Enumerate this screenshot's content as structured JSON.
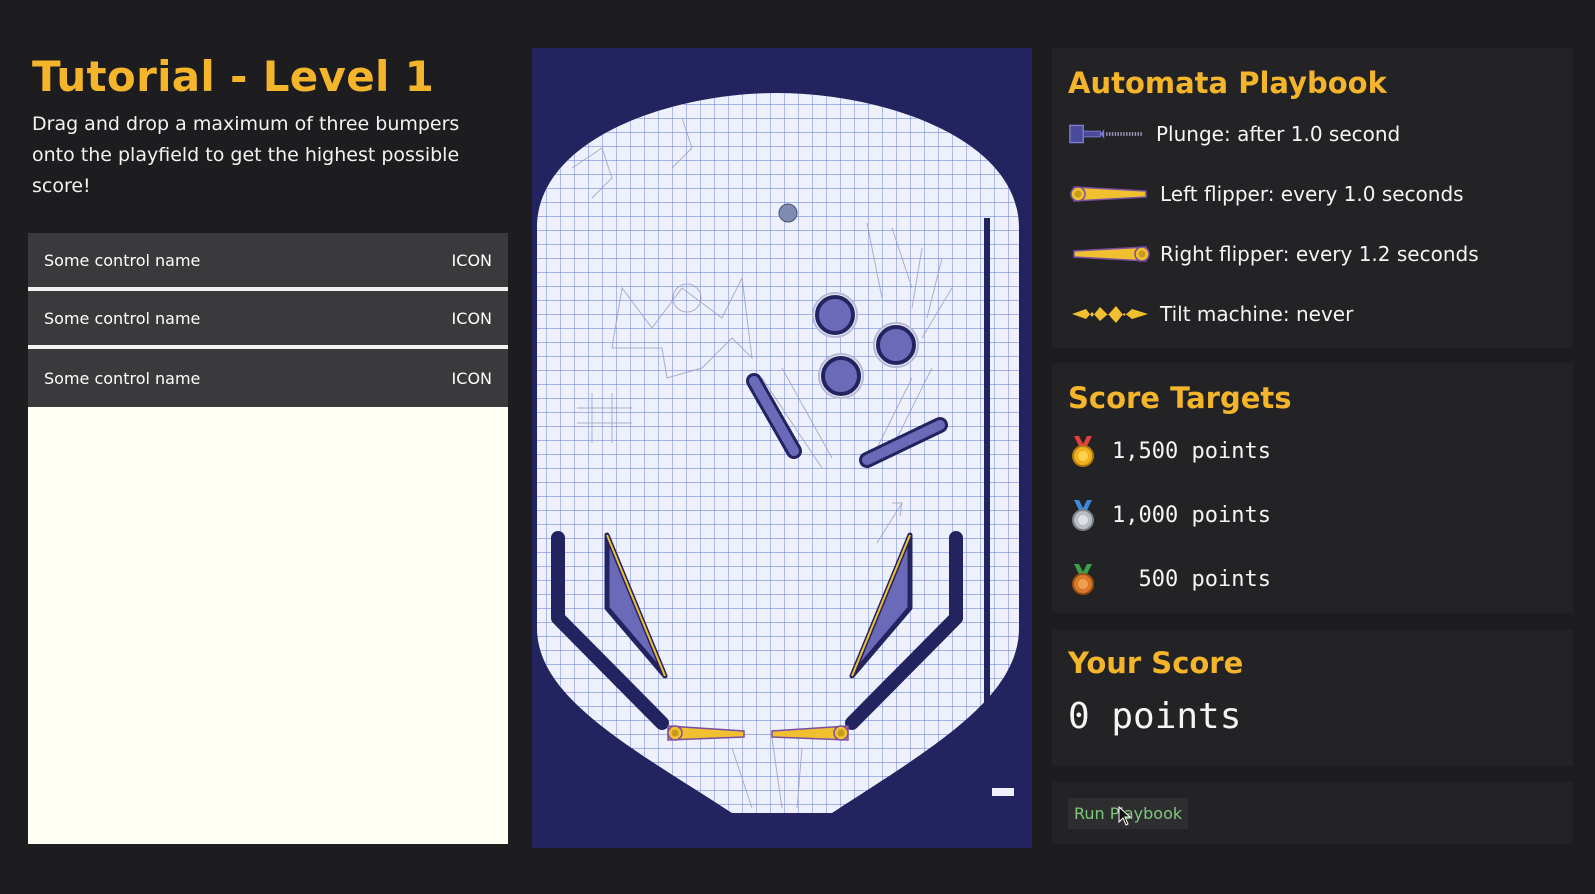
{
  "level": {
    "title": "Tutorial - Level 1",
    "description": "Drag and drop a maximum of three bumpers onto the playfield to get the highest possible score!"
  },
  "controls": [
    {
      "name": "Some control name",
      "icon": "ICON"
    },
    {
      "name": "Some control name",
      "icon": "ICON"
    },
    {
      "name": "Some control name",
      "icon": "ICON"
    }
  ],
  "playbook": {
    "title": "Automata Playbook",
    "items": [
      {
        "icon": "plunger-icon",
        "label": "Plunge: after 1.0 second"
      },
      {
        "icon": "left-flipper-icon",
        "label": "Left flipper: every 1.0 seconds"
      },
      {
        "icon": "right-flipper-icon",
        "label": "Right flipper: every 1.2 seconds"
      },
      {
        "icon": "tilt-icon",
        "label": "Tilt machine: never"
      }
    ]
  },
  "score_targets": {
    "title": "Score Targets",
    "targets": [
      {
        "medal": "gold-medal-icon",
        "points": "1,500 points"
      },
      {
        "medal": "silver-medal-icon",
        "points": "1,000 points"
      },
      {
        "medal": "bronze-medal-icon",
        "points": "  500 points"
      }
    ]
  },
  "your_score": {
    "title": "Your Score",
    "value": "0 points"
  },
  "run_button": "Run Playbook",
  "colors": {
    "accent": "#f4b52b",
    "background": "#1d1d20",
    "panel": "#232326",
    "playfield_border": "#232360",
    "bumper": "#6a6ab8",
    "flipper": "#f0c030",
    "run_text": "#7ec87e"
  }
}
